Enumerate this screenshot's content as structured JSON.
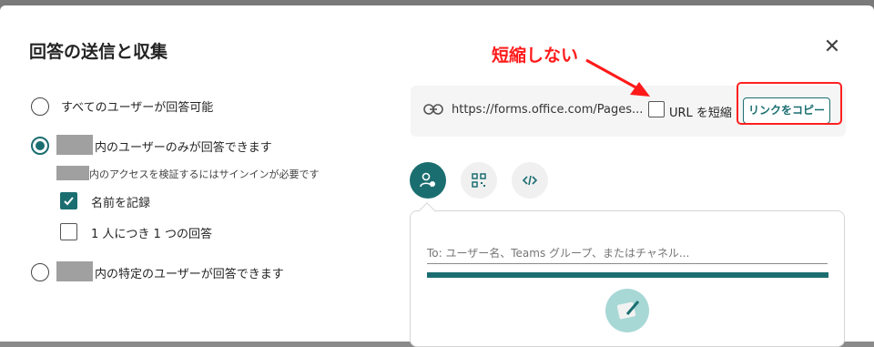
{
  "dialog": {
    "title": "回答の送信と収集",
    "close_icon": "close-icon"
  },
  "options": {
    "anyone": "すべてのユーザーが回答可能",
    "org_only": "内のユーザーのみが回答できます",
    "org_only_sub": "内のアクセスを検証するにはサインインが必要です",
    "record_name": "名前を記録",
    "one_response": "1 人につき 1 つの回答",
    "specific_people": "内の特定のユーザーが回答できます"
  },
  "link": {
    "url": "https://forms.office.com/Pages...",
    "shorten_label": "URL を短縮",
    "copy_label": "リンクをコピー"
  },
  "annotation": {
    "text": "短縮しない",
    "color": "#ff1a1a"
  },
  "share_tabs": [
    "person-share-icon",
    "qr-code-icon",
    "embed-code-icon"
  ],
  "invite": {
    "placeholder": "To: ユーザー名、Teams グループ、またはチャネル..."
  },
  "colors": {
    "accent": "#1b6e70",
    "annotation": "#ff1a1a"
  }
}
